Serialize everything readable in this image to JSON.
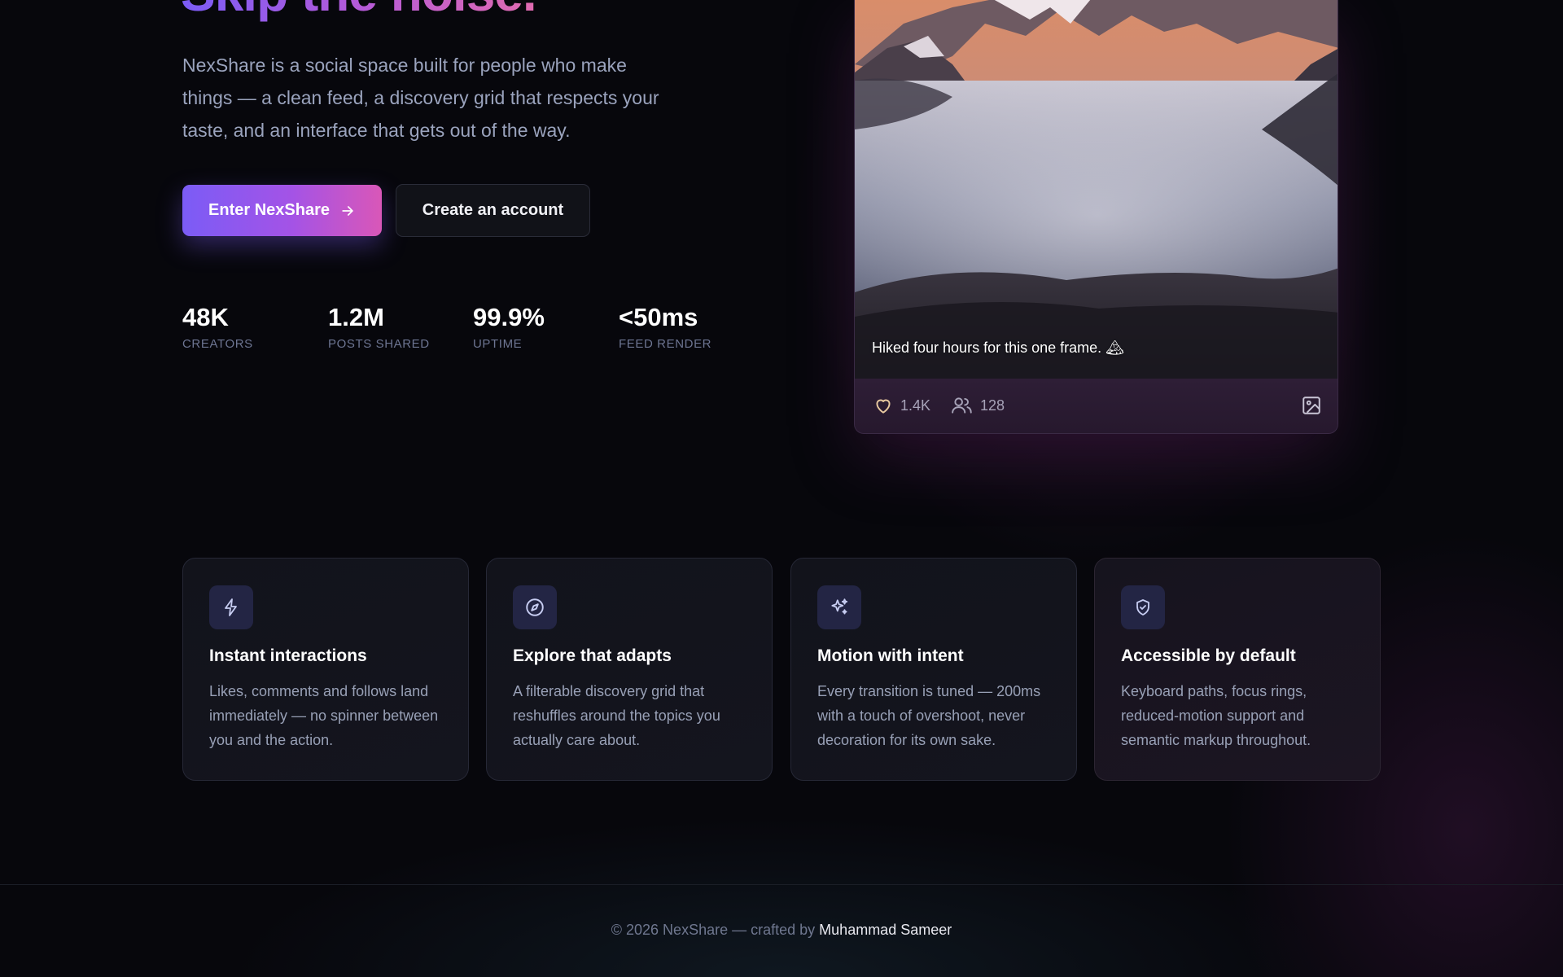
{
  "hero": {
    "title": "Skip the noise.",
    "description": "NexShare is a social space built for people who make things — a clean feed, a discovery grid that respects your taste, and an interface that gets out of the way.",
    "primary_button": "Enter NexShare",
    "secondary_button": "Create an account"
  },
  "stats": [
    {
      "value": "48K",
      "label": "CREATORS"
    },
    {
      "value": "1.2M",
      "label": "POSTS SHARED"
    },
    {
      "value": "99.9%",
      "label": "UPTIME"
    },
    {
      "value": "<50ms",
      "label": "FEED RENDER"
    }
  ],
  "post": {
    "caption": "Hiked four hours for this one frame. 🏔",
    "likes": "1.4K",
    "followers": "128"
  },
  "features": [
    {
      "icon": "lightning-icon",
      "title": "Instant interactions",
      "description": "Likes, comments and follows land immediately — no spinner between you and the action."
    },
    {
      "icon": "compass-icon",
      "title": "Explore that adapts",
      "description": "A filterable discovery grid that reshuffles around the topics you actually care about."
    },
    {
      "icon": "sparkles-icon",
      "title": "Motion with intent",
      "description": "Every transition is tuned — 200ms with a touch of overshoot, never decoration for its own sake."
    },
    {
      "icon": "shield-check-icon",
      "title": "Accessible by default",
      "description": "Keyboard paths, focus rings, reduced-motion support and semantic markup throughout."
    }
  ],
  "footer": {
    "copyright": "© 2026 NexShare — crafted by",
    "author": "Muhammad Sameer"
  },
  "colors": {
    "background": "#07070c",
    "accent_start": "#7b5cf6",
    "accent_end": "#d957b8",
    "icon_tint": "#c7cdf2"
  }
}
